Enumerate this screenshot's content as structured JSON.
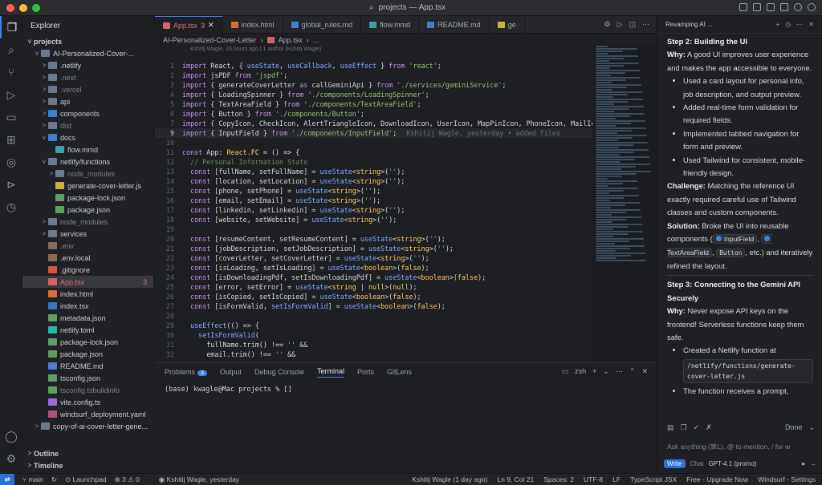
{
  "window": {
    "title": "projects — App.tsx"
  },
  "activity_bar": [
    "files-icon",
    "search-icon",
    "source-control-icon",
    "run-icon",
    "remote-icon",
    "extensions-icon",
    "gitlens-icon",
    "accounts-icon",
    "settings-icon"
  ],
  "explorer": {
    "title": "Explorer",
    "root": "projects",
    "items": [
      {
        "label": "AI-Personalized-Cover-...",
        "depth": 1,
        "chev": "v",
        "icon": "folder",
        "dim": false
      },
      {
        "label": ".netlify",
        "depth": 2,
        "chev": ">",
        "icon": "folder",
        "dim": false
      },
      {
        "label": ".next",
        "depth": 2,
        "chev": ">",
        "icon": "folder",
        "dim": true
      },
      {
        "label": ".vercel",
        "depth": 2,
        "chev": ">",
        "icon": "folder",
        "dim": true
      },
      {
        "label": "api",
        "depth": 2,
        "chev": ">",
        "icon": "folder",
        "dim": false
      },
      {
        "label": "components",
        "depth": 2,
        "chev": ">",
        "icon": "folder-blue",
        "dim": false
      },
      {
        "label": "dist",
        "depth": 2,
        "chev": ">",
        "icon": "folder",
        "dim": true
      },
      {
        "label": "docs",
        "depth": 2,
        "chev": "v",
        "icon": "folder-blue",
        "dim": false
      },
      {
        "label": "flow.mmd",
        "depth": 3,
        "chev": "",
        "icon": "mmd",
        "dim": false
      },
      {
        "label": "netlify/functions",
        "depth": 2,
        "chev": "v",
        "icon": "folder",
        "dim": false
      },
      {
        "label": "node_modules",
        "depth": 3,
        "chev": ">",
        "icon": "folder",
        "dim": true
      },
      {
        "label": "generate-cover-letter.js",
        "depth": 3,
        "chev": "",
        "icon": "js",
        "dim": false
      },
      {
        "label": "package-lock.json",
        "depth": 3,
        "chev": "",
        "icon": "json",
        "dim": false
      },
      {
        "label": "package.json",
        "depth": 3,
        "chev": "",
        "icon": "json",
        "dim": false
      },
      {
        "label": "node_modules",
        "depth": 2,
        "chev": ">",
        "icon": "folder",
        "dim": true
      },
      {
        "label": "services",
        "depth": 2,
        "chev": ">",
        "icon": "folder",
        "dim": false
      },
      {
        "label": ".env",
        "depth": 2,
        "chev": "",
        "icon": "env",
        "dim": true
      },
      {
        "label": ".env.local",
        "depth": 2,
        "chev": "",
        "icon": "env",
        "dim": false
      },
      {
        "label": ".gitignore",
        "depth": 2,
        "chev": "",
        "icon": "git",
        "dim": false
      },
      {
        "label": "App.tsx",
        "depth": 2,
        "chev": "",
        "icon": "react",
        "dim": false,
        "selected": true,
        "badge": "3"
      },
      {
        "label": "index.html",
        "depth": 2,
        "chev": "",
        "icon": "html",
        "dim": false
      },
      {
        "label": "index.tsx",
        "depth": 2,
        "chev": "",
        "icon": "ts",
        "dim": false
      },
      {
        "label": "metadata.json",
        "depth": 2,
        "chev": "",
        "icon": "json",
        "dim": false
      },
      {
        "label": "netlify.toml",
        "depth": 2,
        "chev": "",
        "icon": "toml",
        "dim": false
      },
      {
        "label": "package-lock.json",
        "depth": 2,
        "chev": "",
        "icon": "json",
        "dim": false
      },
      {
        "label": "package.json",
        "depth": 2,
        "chev": "",
        "icon": "json",
        "dim": false
      },
      {
        "label": "README.md",
        "depth": 2,
        "chev": "",
        "icon": "md",
        "dim": false
      },
      {
        "label": "tsconfig.json",
        "depth": 2,
        "chev": "",
        "icon": "json",
        "dim": false
      },
      {
        "label": "tsconfig.tsbuildinfo",
        "depth": 2,
        "chev": "",
        "icon": "json",
        "dim": true
      },
      {
        "label": "vite.config.ts",
        "depth": 2,
        "chev": "",
        "icon": "vite",
        "dim": false
      },
      {
        "label": "windsurf_deployment.yaml",
        "depth": 2,
        "chev": "",
        "icon": "yaml",
        "dim": false
      },
      {
        "label": "copy-of-ai-cover-letter-gene...",
        "depth": 1,
        "chev": ">",
        "icon": "folder",
        "dim": false
      }
    ],
    "outline": "Outline",
    "timeline": "Timeline"
  },
  "tabs": [
    {
      "label": "App.tsx",
      "active": true,
      "badge": "3",
      "icon": "react"
    },
    {
      "label": "index.html",
      "active": false,
      "icon": "html"
    },
    {
      "label": "global_rules.md",
      "active": false,
      "icon": "md"
    },
    {
      "label": "flow.mmd",
      "active": false,
      "icon": "mmd"
    },
    {
      "label": "README.md",
      "active": false,
      "icon": "md"
    },
    {
      "label": "ge",
      "active": false,
      "icon": "js"
    }
  ],
  "breadcrumb": [
    "AI-Personalized-Cover-Letter",
    "App.tsx",
    "..."
  ],
  "blame_top": "Kshitij Wagle, 16 hours ago | 1 author (Kshitij Wagle)",
  "code": [
    {
      "n": "1",
      "t": "import React, { useState, useCallback, useEffect } from 'react';"
    },
    {
      "n": "2",
      "t": "import jsPDF from 'jspdf';"
    },
    {
      "n": "3",
      "t": "import { generateCoverLetter as callGeminiApi } from './services/geminiService';"
    },
    {
      "n": "4",
      "t": "import { LoadingSpinner } from './components/LoadingSpinner';"
    },
    {
      "n": "5",
      "t": "import { TextAreaField } from './components/TextAreaField';"
    },
    {
      "n": "6",
      "t": "import { Button } from './components/Button';"
    },
    {
      "n": "7",
      "t": "import { CopyIcon, CheckIcon, AlertTriangleIcon, DownloadIcon, UserIcon, MapPinIcon, PhoneIcon, MailIc"
    },
    {
      "n": "9",
      "t": "import { InputField } from './components/InputField';",
      "cur": true,
      "blame": "Kshitij Wagle, yesterday • added files"
    },
    {
      "n": "10",
      "t": ""
    },
    {
      "n": "11",
      "t": "const App: React.FC = () => {"
    },
    {
      "n": "12",
      "t": "  // Personal Information State"
    },
    {
      "n": "13",
      "t": "  const [fullName, setFullName] = useState<string>('');"
    },
    {
      "n": "14",
      "t": "  const [location, setLocation] = useState<string>('');"
    },
    {
      "n": "15",
      "t": "  const [phone, setPhone] = useState<string>('');"
    },
    {
      "n": "16",
      "t": "  const [email, setEmail] = useState<string>('');"
    },
    {
      "n": "17",
      "t": "  const [linkedin, setLinkedin] = useState<string>('');"
    },
    {
      "n": "18",
      "t": "  const [website, setWebsite] = useState<string>('');"
    },
    {
      "n": "19",
      "t": ""
    },
    {
      "n": "20",
      "t": "  const [resumeContent, setResumeContent] = useState<string>('');"
    },
    {
      "n": "21",
      "t": "  const [jobDescription, setJobDescription] = useState<string>('');"
    },
    {
      "n": "22",
      "t": "  const [coverLetter, setCoverLetter] = useState<string>('');"
    },
    {
      "n": "23",
      "t": "  const [isLoading, setIsLoading] = useState<boolean>(false);"
    },
    {
      "n": "24",
      "t": "  const [isDownloadingPdf, setIsDownloadingPdf] = useState<boolean>(false);"
    },
    {
      "n": "25",
      "t": "  const [error, setError] = useState<string | null>(null);"
    },
    {
      "n": "26",
      "t": "  const [isCopied, setIsCopied] = useState<boolean>(false);"
    },
    {
      "n": "27",
      "t": "  const [isFormValid, setIsFormValid] = useState<boolean>(false);"
    },
    {
      "n": "28",
      "t": ""
    },
    {
      "n": "29",
      "t": "  useEffect(() => {"
    },
    {
      "n": "30",
      "t": "    setIsFormValid("
    },
    {
      "n": "31",
      "t": "      fullName.trim() !== '' &&"
    },
    {
      "n": "32",
      "t": "      email.trim() !== '' &&"
    }
  ],
  "panel": {
    "tabs": [
      {
        "label": "Problems",
        "badge": "3"
      },
      {
        "label": "Output"
      },
      {
        "label": "Debug Console"
      },
      {
        "label": "Terminal",
        "on": true
      },
      {
        "label": "Ports"
      },
      {
        "label": "GitLens"
      }
    ],
    "shell": "zsh",
    "prompt": "(base) kwagle@Mac projects % []"
  },
  "chat": {
    "title": "Revamping AI ...",
    "step2_title": "Step 2: Building the UI",
    "why_label": "Why:",
    "step2_why": "A good UI improves user experience and makes the app accessible to everyone.",
    "step2_bullets": [
      "Used a card layout for personal info, job description, and output preview.",
      "Added real-time form validation for required fields.",
      "Implemented tabbed navigation for form and preview.",
      "Used Tailwind for consistent, mobile-friendly design."
    ],
    "challenge_label": "Challenge:",
    "challenge": "Matching the reference UI exactly required careful use of Tailwind classes and custom components.",
    "solution_label": "Solution:",
    "solution_a": "Broke the UI into reusable components (",
    "chip1": "InputField",
    "chip2": "TextAreaField",
    "chip3": "Button",
    "solution_b": ", etc.) and iteratively refined the layout.",
    "step3_title": "Step 3: Connecting to the Gemini API Securely",
    "step3_why": "Never expose API keys on the frontend! Serverless functions keep them safe.",
    "step3_bullet1": "Created a Netlify function at",
    "step3_path": "/netlify/functions/generate-cover-letter.js",
    "step3_bullet2": "The function receives a prompt,",
    "done": "Done",
    "input_placeholder": "Ask anything (⌘L), @ to mention, / for w",
    "mode_write": "Write",
    "mode_chat": "Chat",
    "model": "GPT-4.1 (promo)"
  },
  "status": {
    "branch": "main",
    "launchpad": "Launchpad",
    "problems": "3",
    "warnings": "0",
    "blame": "Kshitij Wagle, yesterday",
    "author": "Kshitij Wagle (1 day ago)",
    "position": "Ln 9, Col 21",
    "spaces": "Spaces: 2",
    "encoding": "UTF-8",
    "eol": "LF",
    "language": "TypeScript JSX",
    "upgrade": "Free - Upgrade Now",
    "windsurf": "Windsurf - Settings"
  },
  "colors": {
    "accent": "#3b82f6",
    "bg": "#1e1f22",
    "sidebar": "#202124"
  }
}
